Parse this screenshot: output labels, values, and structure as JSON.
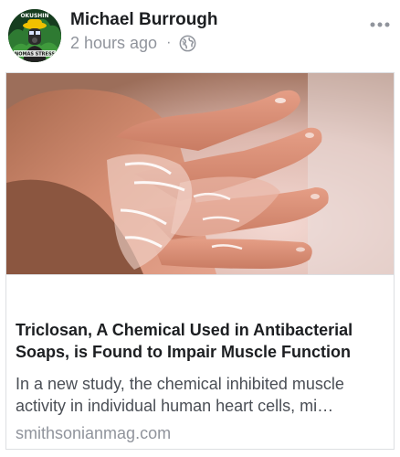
{
  "post": {
    "author": "Michael Burrough",
    "timestamp": "2 hours ago",
    "separator": "·",
    "privacy_icon": "globe-icon",
    "menu_icon": "more-options-icon",
    "avatar_icon": "masked-figure-avatar",
    "avatar_text_top": "OKUSHIN",
    "avatar_text_bottom": "NOMAS STRESS"
  },
  "link": {
    "title": "Triclosan, A Chemical Used in Antibacterial Soaps, is Found to Impair Muscle Function",
    "description": "In a new study, the chemical inhibited muscle activity in individual human heart cells, mi…",
    "domain": "smithsonianmag.com",
    "image_subject": "hand-with-soapy-water-photo"
  },
  "colors": {
    "name": "#1c1e21",
    "meta": "#90949c",
    "description": "#4b4f56",
    "border": "#dddfe2"
  }
}
